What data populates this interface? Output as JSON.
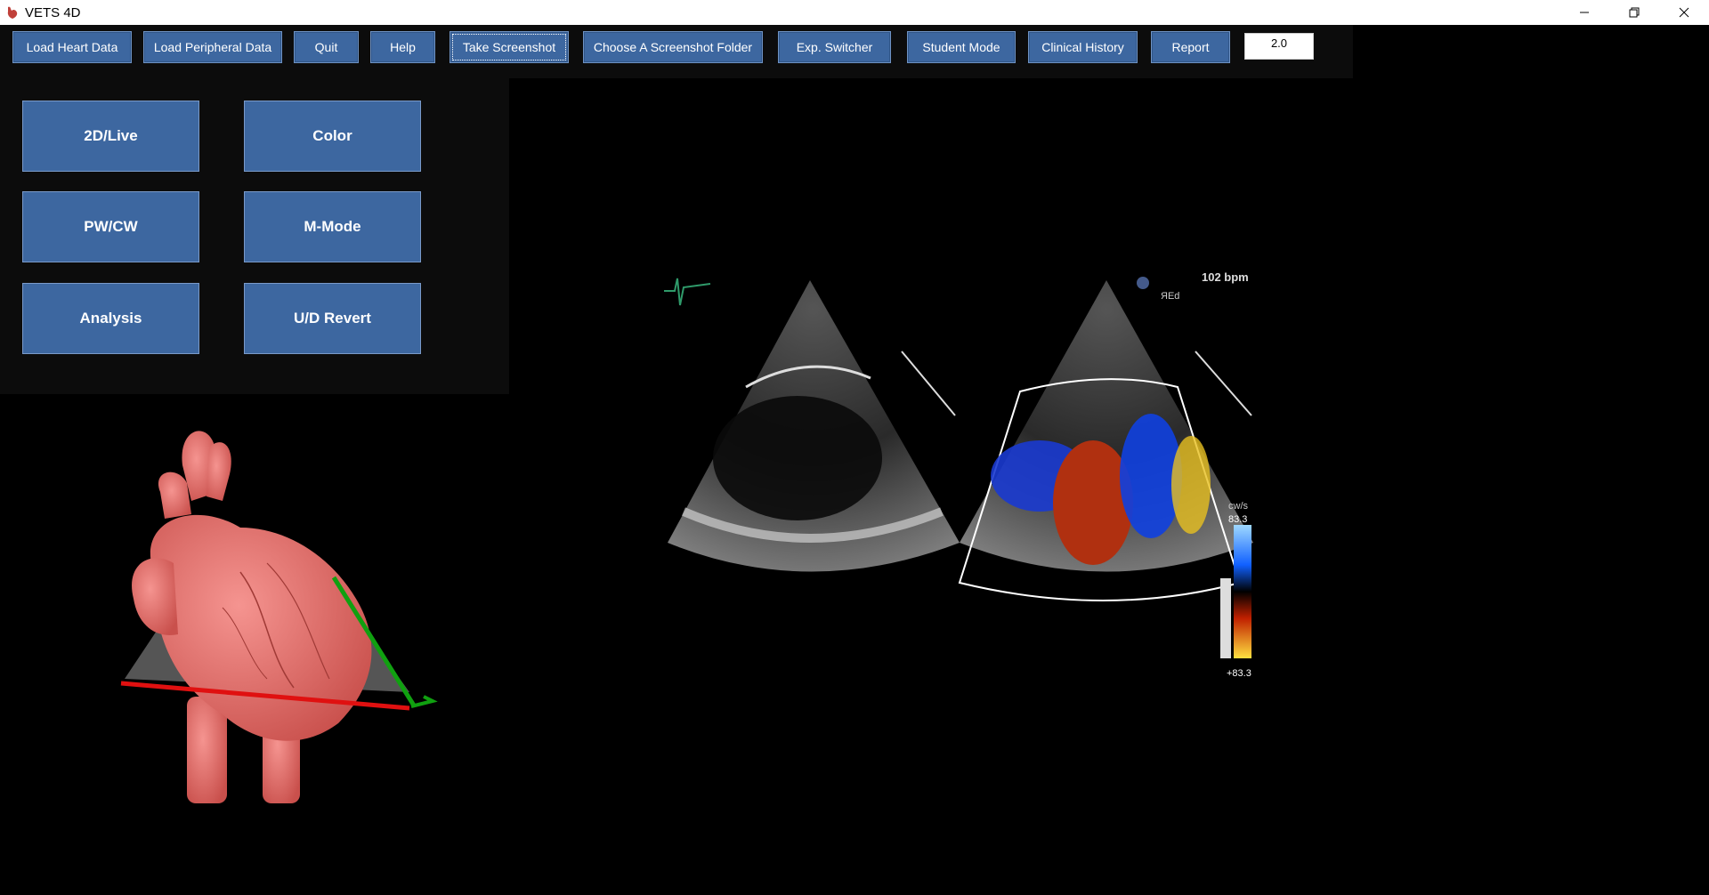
{
  "window": {
    "title": "VETS 4D",
    "controls": {
      "minimize": "minimize-icon",
      "maximize": "restore-icon",
      "close": "close-icon"
    }
  },
  "toolbar": {
    "buttons": [
      "Load Heart Data",
      "Load Peripheral Data",
      "Quit",
      "Help",
      "Take Screenshot",
      "Choose A Screenshot Folder",
      "Exp. Switcher",
      "Student Mode",
      "Clinical History",
      "Report"
    ],
    "version_value": "2.0"
  },
  "modes": {
    "buttons": [
      "2D/Live",
      "Color",
      "PW/CW",
      "M-Mode",
      "Analysis",
      "U/D Revert"
    ]
  },
  "ultrasound": {
    "right_label_top": "102 bpm",
    "right_label_sub": "ЯEd",
    "scale_label": "cw/s",
    "scale_top": "83.3",
    "scale_bottom": "+83.3"
  },
  "colors": {
    "button_bg": "#3d67a0",
    "heart": "#ec7470",
    "axis_red": "#e01010",
    "axis_green": "#10a010"
  }
}
